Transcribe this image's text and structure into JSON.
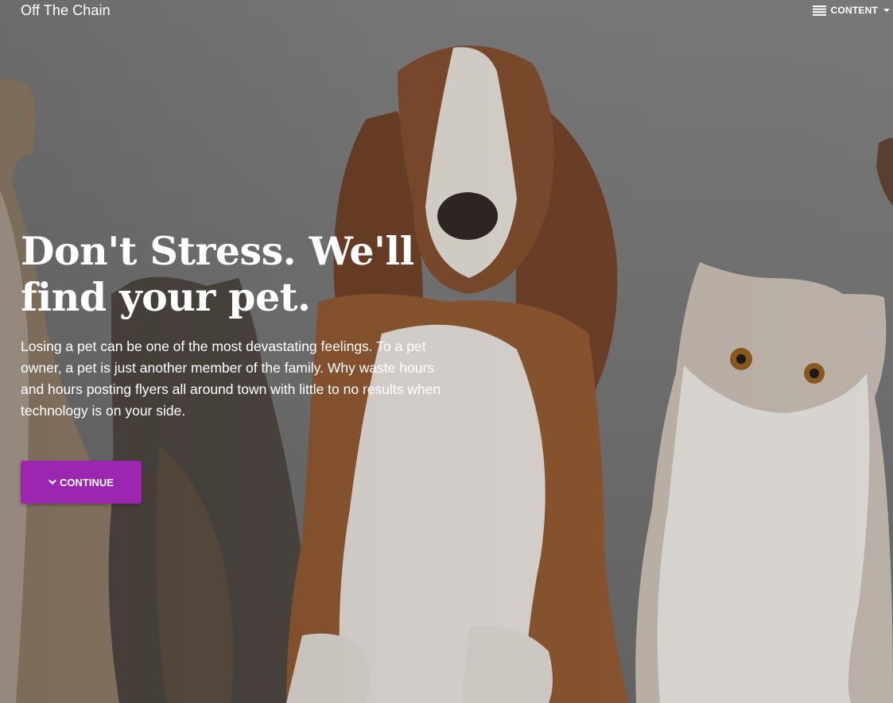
{
  "header": {
    "brand": "Off The Chain",
    "menu_label": "CONTENT",
    "menu_icon": "hamburger-icon",
    "caret_icon": "caret-down-icon"
  },
  "hero": {
    "headline_line1": "Don't Stress. We'll",
    "headline_line2": "find your pet.",
    "body": "Losing a pet can be one of the most devastating feelings. To a pet owner, a pet is just another member of the family. Why waste hours and hours posting flyers all around town with little to no results when technology is on your side.",
    "button_label": "CONTINUE",
    "button_icon": "chevron-down-icon",
    "background_image": "dogs-and-cats-photo"
  },
  "colors": {
    "accent": "#9b27b0",
    "text": "#ffffff",
    "background": "#747474"
  }
}
